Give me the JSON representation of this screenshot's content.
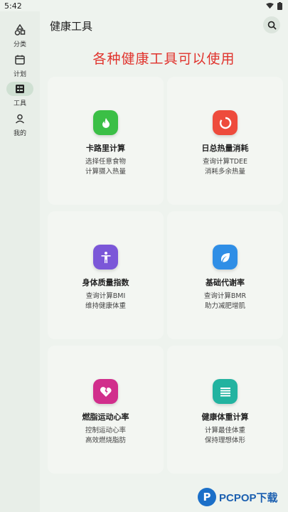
{
  "status": {
    "time": "5:42"
  },
  "rail": [
    {
      "label": "分类",
      "icon": "shapes-icon"
    },
    {
      "label": "计划",
      "icon": "calendar-icon"
    },
    {
      "label": "工具",
      "icon": "tools-icon",
      "active": true
    },
    {
      "label": "我的",
      "icon": "person-icon"
    }
  ],
  "header": {
    "title": "健康工具"
  },
  "banner": "各种健康工具可以使用",
  "cards": [
    {
      "title": "卡路里计算",
      "line1": "选择任意食物",
      "line2": "计算摄入热量",
      "color": "#3bbf46",
      "icon": "flame-icon"
    },
    {
      "title": "日总热量消耗",
      "line1": "查询计算TDEE",
      "line2": "消耗多余热量",
      "color": "#ee4b3c",
      "icon": "ring-icon"
    },
    {
      "title": "身体质量指数",
      "line1": "查询计算BMI",
      "line2": "维持健康体重",
      "color": "#7b57d8",
      "icon": "person-icon"
    },
    {
      "title": "基础代谢率",
      "line1": "查询计算BMR",
      "line2": "助力减肥增肌",
      "color": "#2f8ee6",
      "icon": "leaf-icon"
    },
    {
      "title": "燃脂运动心率",
      "line1": "控制运动心率",
      "line2": "高效燃烧脂肪",
      "color": "#d12e8c",
      "icon": "broken-heart-icon"
    },
    {
      "title": "健康体重计算",
      "line1": "计算最佳体重",
      "line2": "保持理想体形",
      "color": "#22b3a0",
      "icon": "list-icon"
    }
  ],
  "watermark": {
    "text": "PCPOP下载"
  }
}
